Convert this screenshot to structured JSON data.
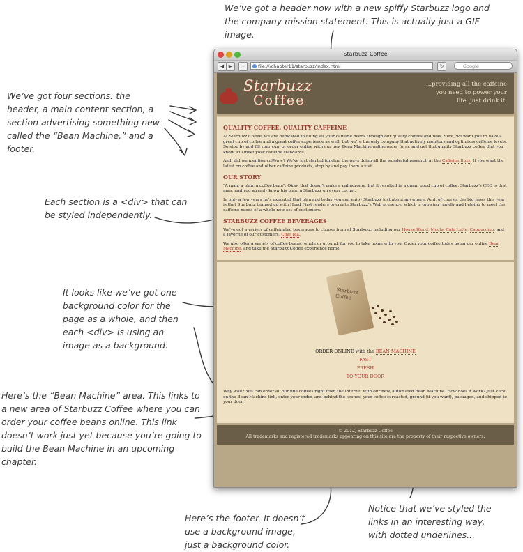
{
  "annotations": {
    "header": "We’ve got a header now with a new spiffy Starbuzz logo and the company mission statement. This is actually just a GIF image.",
    "sections": "We’ve got four sections: the header, a main content section, a section advertising something new called the “Bean Machine,” and a footer.",
    "div": "Each section is a <div> that can be styled independently.",
    "background": "It looks like we’ve got one background color for the page as a whole, and then each <div> is using an image as a background.",
    "bean_area": "Here’s the “Bean Machine” area. This links to a new area of Starbuzz Coffee where you can order your coffee beans online. This link doesn’t work just yet because you’re going to build the Bean Machine in an upcoming chapter.",
    "footer": "Here’s the footer. It doesn’t use a background image, just a background color.",
    "links": "Notice that we’ve styled the links in an interesting way, with dotted underlines..."
  },
  "window": {
    "title": "Starbuzz Coffee",
    "url": "file:///chapter11/starbuzz/index.html",
    "search_placeholder": "Google"
  },
  "header": {
    "logo_line1": "Starbuzz",
    "logo_line2": "Coffee",
    "mission_l1": "...providing all the caffeine",
    "mission_l2": "you need to power your",
    "mission_l3": "life. just drink it."
  },
  "main": {
    "h1": "QUALITY COFFEE, QUALITY CAFFEINE",
    "p1": "At Starbuzz Coffee, we are dedicated to filling all your caffeine needs through our quality coffees and teas. Sure, we want you to have a great cup of coffee and a great coffee experience as well, but we’re the only company that actively monitors and optimizes caffeine levels. So stop by and fill your cup, or order online with our new Bean Machine online order form, and get that quality Starbuzz coffee that you know will meet your caffeine standards.",
    "p2_a": "And, did we mention ",
    "p2_em": "caffeine",
    "p2_b": "? We’ve just started funding the guys doing all the wonderful research at the ",
    "p2_link": "Caffeine Buzz",
    "p2_c": ". If you want the latest on coffee and other caffeine products, stop by and pay them a visit.",
    "h2": "OUR STORY",
    "p3": "\"A man, a plan, a coffee bean\". Okay, that doesn’t make a palindrome, but it resulted in a damn good cup of coffee. Starbuzz’s CEO is that man, and you already know his plan: a Starbuzz on every corner.",
    "p4": "In only a few years he’s executed that plan and today you can enjoy Starbuzz just about anywhere. And, of course, the big news this year is that Starbuzz teamed up with Head First readers to create Starbuzz’s Web presence, which is growing rapidly and helping to meet the caffeine needs of a whole new set of customers.",
    "h3": "STARBUZZ COFFEE BEVERAGES",
    "p5_a": "We’ve got a variety of caffeinated beverages to choose from at Starbuzz, including our ",
    "p5_l1": "House Blend",
    "p5_b": ", ",
    "p5_l2": "Mocha Cafe Latte",
    "p5_c": ", ",
    "p5_l3": "Cappuccino",
    "p5_d": ", and a favorite of our customers, ",
    "p5_l4": "Chai Tea",
    "p5_e": ".",
    "p6_a": "We also offer a variety of coffee beans, whole or ground, for you to take home with you. Order your coffee today using our online ",
    "p6_link": "Bean Machine",
    "p6_b": ", and take the Starbuzz Coffee experience home."
  },
  "bean": {
    "bag_l1": "Starbuzz",
    "bag_l2": "Coffee",
    "order_prefix": "ORDER ONLINE with the ",
    "order_link": "BEAN MACHINE",
    "fast": "FAST",
    "fresh": "FRESH",
    "door": "TO YOUR DOOR",
    "why": "Why wait? You can order all our fine coffees right from the Internet with our new, automated Bean Machine. How does it work? Just click on the Bean Machine link, enter your order, and behind the scenes, your coffee is roasted, ground (if you want), packaged, and shipped to your door."
  },
  "footer": {
    "line1": "© 2012, Starbuzz Coffee",
    "line2": "All trademarks and registered trademarks appearing on this site are the property of their respective owners."
  },
  "colors": {
    "header_bg": "#6b5e48",
    "section_bg": "#efe1c4",
    "link": "#b13b2f",
    "heading": "#963a30"
  }
}
